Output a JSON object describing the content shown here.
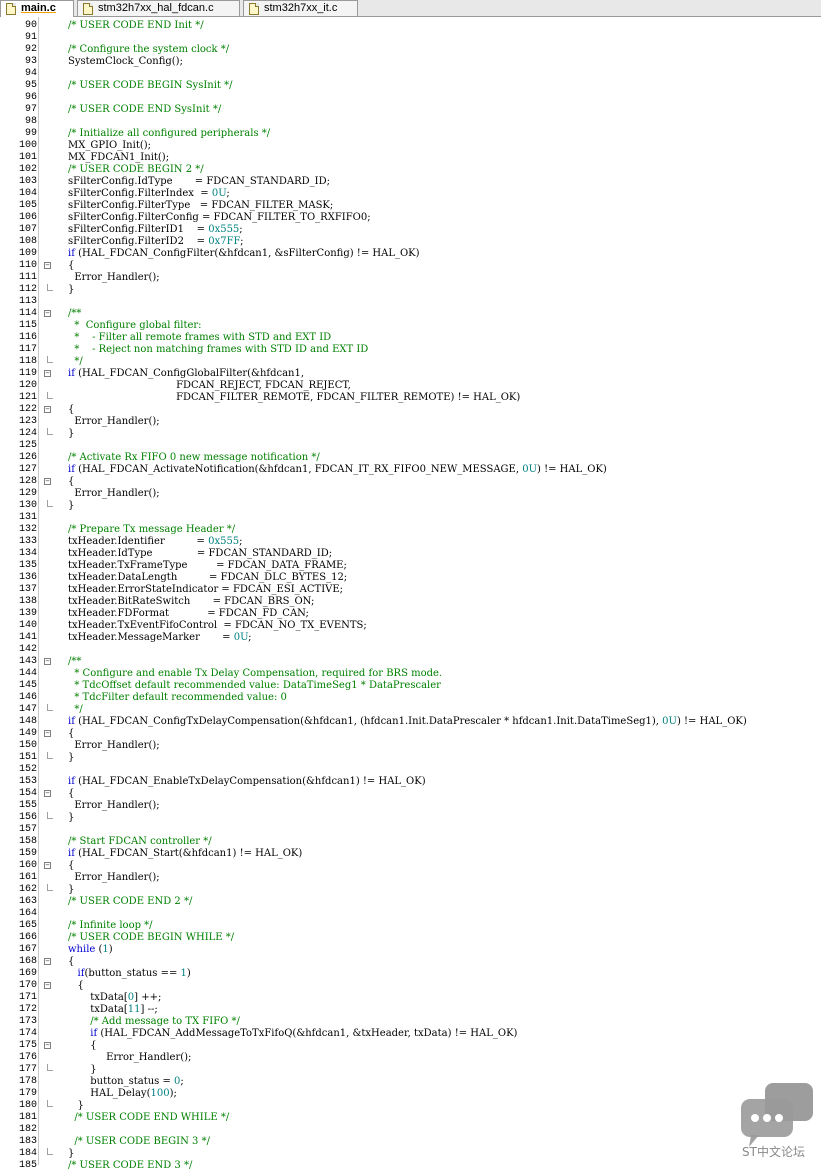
{
  "tabs": [
    {
      "label": "main.c",
      "active": true
    },
    {
      "label": "stm32h7xx_hal_fdcan.c",
      "active": false
    },
    {
      "label": "stm32h7xx_it.c",
      "active": false
    }
  ],
  "colors": {
    "comment": "#008000",
    "keyword": "#0000d0",
    "number": "#008080"
  },
  "lines": [
    {
      "n": "90",
      "code": "/* USER CODE END Init */"
    },
    {
      "n": "91",
      "code": ""
    },
    {
      "n": "92",
      "code": "/* Configure the system clock */"
    },
    {
      "n": "93",
      "code": "SystemClock_Config();"
    },
    {
      "n": "94",
      "code": ""
    },
    {
      "n": "95",
      "code": "/* USER CODE BEGIN SysInit */"
    },
    {
      "n": "96",
      "code": ""
    },
    {
      "n": "97",
      "code": "/* USER CODE END SysInit */"
    },
    {
      "n": "98",
      "code": ""
    },
    {
      "n": "99",
      "code": "/* Initialize all configured peripherals */"
    },
    {
      "n": "100",
      "code": "MX_GPIO_Init();"
    },
    {
      "n": "101",
      "code": "MX_FDCAN1_Init();"
    },
    {
      "n": "102",
      "code": "/* USER CODE BEGIN 2 */"
    },
    {
      "n": "103",
      "code": "sFilterConfig.IdType       = FDCAN_STANDARD_ID;"
    },
    {
      "n": "104",
      "code": "sFilterConfig.FilterIndex  = 0U;"
    },
    {
      "n": "105",
      "code": "sFilterConfig.FilterType   = FDCAN_FILTER_MASK;"
    },
    {
      "n": "106",
      "code": "sFilterConfig.FilterConfig = FDCAN_FILTER_TO_RXFIFO0;"
    },
    {
      "n": "107",
      "code": "sFilterConfig.FilterID1    = 0x555;"
    },
    {
      "n": "108",
      "code": "sFilterConfig.FilterID2    = 0x7FF;"
    },
    {
      "n": "109",
      "code": "if (HAL_FDCAN_ConfigFilter(&hfdcan1, &sFilterConfig) != HAL_OK)"
    },
    {
      "n": "110",
      "code": "{",
      "fold": "open"
    },
    {
      "n": "111",
      "code": "  Error_Handler();"
    },
    {
      "n": "112",
      "code": "}",
      "fold": "end"
    },
    {
      "n": "113",
      "code": ""
    },
    {
      "n": "114",
      "code": "/**",
      "fold": "open"
    },
    {
      "n": "115",
      "code": "  *  Configure global filter:"
    },
    {
      "n": "116",
      "code": "  *    - Filter all remote frames with STD and EXT ID"
    },
    {
      "n": "117",
      "code": "  *    - Reject non matching frames with STD ID and EXT ID"
    },
    {
      "n": "118",
      "code": "  */",
      "fold": "end"
    },
    {
      "n": "119",
      "code": "if (HAL_FDCAN_ConfigGlobalFilter(&hfdcan1,",
      "fold": "open"
    },
    {
      "n": "120",
      "code": "                                  FDCAN_REJECT, FDCAN_REJECT,"
    },
    {
      "n": "121",
      "code": "                                  FDCAN_FILTER_REMOTE, FDCAN_FILTER_REMOTE) != HAL_OK)",
      "fold": "end"
    },
    {
      "n": "122",
      "code": "{",
      "fold": "open"
    },
    {
      "n": "123",
      "code": "  Error_Handler();"
    },
    {
      "n": "124",
      "code": "}",
      "fold": "end"
    },
    {
      "n": "125",
      "code": ""
    },
    {
      "n": "126",
      "code": "/* Activate Rx FIFO 0 new message notification */"
    },
    {
      "n": "127",
      "code": "if (HAL_FDCAN_ActivateNotification(&hfdcan1, FDCAN_IT_RX_FIFO0_NEW_MESSAGE, 0U) != HAL_OK)"
    },
    {
      "n": "128",
      "code": "{",
      "fold": "open"
    },
    {
      "n": "129",
      "code": "  Error_Handler();"
    },
    {
      "n": "130",
      "code": "}",
      "fold": "end"
    },
    {
      "n": "131",
      "code": ""
    },
    {
      "n": "132",
      "code": "/* Prepare Tx message Header */"
    },
    {
      "n": "133",
      "code": "txHeader.Identifier          = 0x555;"
    },
    {
      "n": "134",
      "code": "txHeader.IdType              = FDCAN_STANDARD_ID;"
    },
    {
      "n": "135",
      "code": "txHeader.TxFrameType         = FDCAN_DATA_FRAME;"
    },
    {
      "n": "136",
      "code": "txHeader.DataLength          = FDCAN_DLC_BYTES_12;"
    },
    {
      "n": "137",
      "code": "txHeader.ErrorStateIndicator = FDCAN_ESI_ACTIVE;"
    },
    {
      "n": "138",
      "code": "txHeader.BitRateSwitch       = FDCAN_BRS_ON;"
    },
    {
      "n": "139",
      "code": "txHeader.FDFormat            = FDCAN_FD_CAN;"
    },
    {
      "n": "140",
      "code": "txHeader.TxEventFifoControl  = FDCAN_NO_TX_EVENTS;"
    },
    {
      "n": "141",
      "code": "txHeader.MessageMarker       = 0U;"
    },
    {
      "n": "142",
      "code": ""
    },
    {
      "n": "143",
      "code": "/**",
      "fold": "open"
    },
    {
      "n": "144",
      "code": "  * Configure and enable Tx Delay Compensation, required for BRS mode."
    },
    {
      "n": "145",
      "code": "  * TdcOffset default recommended value: DataTimeSeg1 * DataPrescaler"
    },
    {
      "n": "146",
      "code": "  * TdcFilter default recommended value: 0"
    },
    {
      "n": "147",
      "code": "  */",
      "fold": "end"
    },
    {
      "n": "148",
      "code": "if (HAL_FDCAN_ConfigTxDelayCompensation(&hfdcan1, (hfdcan1.Init.DataPrescaler * hfdcan1.Init.DataTimeSeg1), 0U) != HAL_OK)"
    },
    {
      "n": "149",
      "code": "{",
      "fold": "open"
    },
    {
      "n": "150",
      "code": "  Error_Handler();"
    },
    {
      "n": "151",
      "code": "}",
      "fold": "end"
    },
    {
      "n": "152",
      "code": ""
    },
    {
      "n": "153",
      "code": "if (HAL_FDCAN_EnableTxDelayCompensation(&hfdcan1) != HAL_OK)"
    },
    {
      "n": "154",
      "code": "{",
      "fold": "open"
    },
    {
      "n": "155",
      "code": "  Error_Handler();"
    },
    {
      "n": "156",
      "code": "}",
      "fold": "end"
    },
    {
      "n": "157",
      "code": ""
    },
    {
      "n": "158",
      "code": "/* Start FDCAN controller */"
    },
    {
      "n": "159",
      "code": "if (HAL_FDCAN_Start(&hfdcan1) != HAL_OK)"
    },
    {
      "n": "160",
      "code": "{",
      "fold": "open"
    },
    {
      "n": "161",
      "code": "  Error_Handler();"
    },
    {
      "n": "162",
      "code": "}",
      "fold": "end"
    },
    {
      "n": "163",
      "code": "/* USER CODE END 2 */"
    },
    {
      "n": "164",
      "code": ""
    },
    {
      "n": "165",
      "code": "/* Infinite loop */"
    },
    {
      "n": "166",
      "code": "/* USER CODE BEGIN WHILE */"
    },
    {
      "n": "167",
      "code": "while (1)"
    },
    {
      "n": "168",
      "code": "{",
      "fold": "open"
    },
    {
      "n": "169",
      "code": "   if(button_status == 1)"
    },
    {
      "n": "170",
      "code": "   {",
      "fold": "open"
    },
    {
      "n": "171",
      "code": "       txData[0] ++;"
    },
    {
      "n": "172",
      "code": "       txData[11] --;"
    },
    {
      "n": "173",
      "code": "       /* Add message to TX FIFO */"
    },
    {
      "n": "174",
      "code": "       if (HAL_FDCAN_AddMessageToTxFifoQ(&hfdcan1, &txHeader, txData) != HAL_OK)"
    },
    {
      "n": "175",
      "code": "       {",
      "fold": "open"
    },
    {
      "n": "176",
      "code": "            Error_Handler();"
    },
    {
      "n": "177",
      "code": "       }",
      "fold": "end"
    },
    {
      "n": "178",
      "code": "       button_status = 0;"
    },
    {
      "n": "179",
      "code": "       HAL_Delay(100);"
    },
    {
      "n": "180",
      "code": "   }",
      "fold": "end"
    },
    {
      "n": "181",
      "code": "  /* USER CODE END WHILE */"
    },
    {
      "n": "182",
      "code": ""
    },
    {
      "n": "183",
      "code": "  /* USER CODE BEGIN 3 */"
    },
    {
      "n": "184",
      "code": "}",
      "fold": "end"
    },
    {
      "n": "185",
      "code": "/* USER CODE END 3 */"
    }
  ],
  "watermark": {
    "text": "ST中文论坛",
    "icon": "chat-bubbles-icon"
  }
}
